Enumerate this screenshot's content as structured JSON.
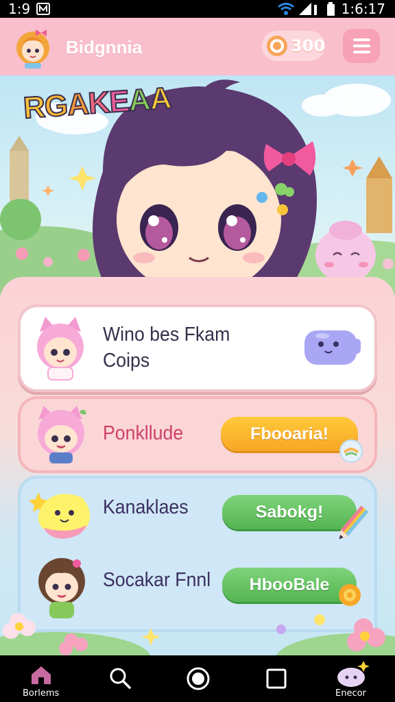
{
  "status_bar": {
    "time": "1:9",
    "clock": "1:6:17"
  },
  "header": {
    "app_title": "Bidgnnia",
    "coins": "300"
  },
  "hero": {
    "title_letters": [
      {
        "ch": "R",
        "color": "#f7c23a"
      },
      {
        "ch": "G",
        "color": "#f6b338"
      },
      {
        "ch": "A",
        "color": "#f29a3a"
      },
      {
        "ch": "K",
        "color": "#ef6a7f"
      },
      {
        "ch": "E",
        "color": "#e85d9a"
      },
      {
        "ch": "A",
        "color": "#86c95a"
      },
      {
        "ch": "A",
        "color": "#f4c53a"
      }
    ]
  },
  "cards": [
    {
      "text_line1": "Wino bes Fkam",
      "text_line2": "Coips"
    },
    {
      "text": "Ponkllude",
      "button": "Fbooaria!"
    },
    {
      "text": "Kanaklaes",
      "button": "Sabokg!"
    },
    {
      "text": "Socakar Fnnl",
      "button": "HbooBale"
    }
  ],
  "bottom_nav": {
    "left_label": "Borlems",
    "right_label": "Enecor"
  },
  "colors": {
    "header_bg": "#f9bfcd",
    "accent_orange": "#f7a626",
    "accent_green": "#54b552",
    "text_pink": "#cc3f6b"
  }
}
